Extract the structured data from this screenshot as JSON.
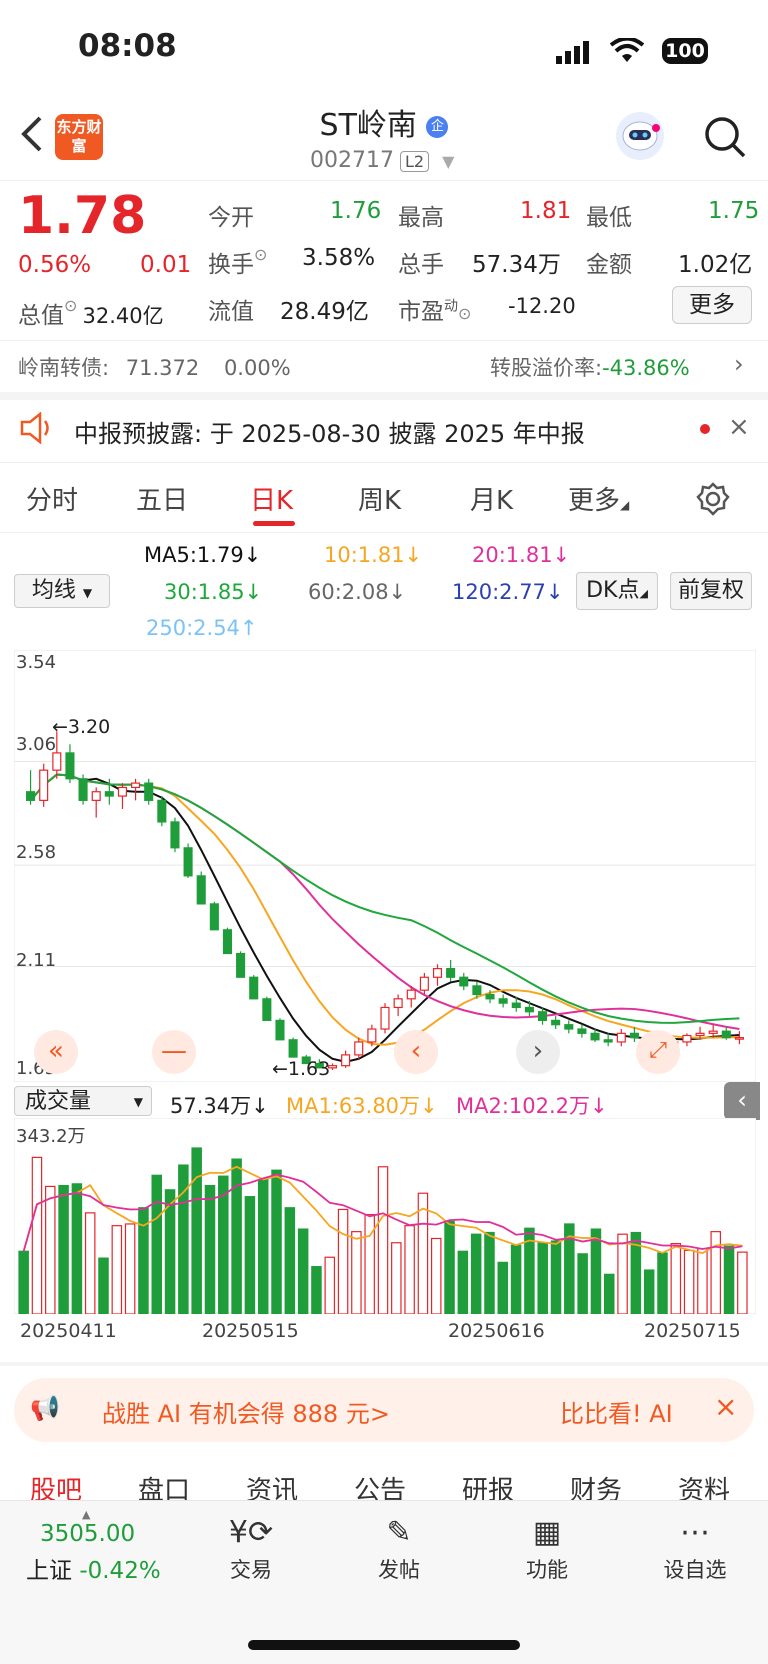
{
  "status": {
    "time": "08:08",
    "battery": "100"
  },
  "header": {
    "logo": "东方财富",
    "title": "ST岭南",
    "code": "002717",
    "level": "L2"
  },
  "quote": {
    "price": "1.78",
    "change_pct": "0.56%",
    "change": "0.01",
    "open_label": "今开",
    "open": "1.76",
    "high_label": "最高",
    "high": "1.81",
    "low_label": "最低",
    "low": "1.75",
    "turnover_label": "换手",
    "turnover": "3.58%",
    "volume_label": "总手",
    "volume": "57.34万",
    "amount_label": "金额",
    "amount": "1.02亿",
    "mktcap_label": "总值",
    "mktcap": "32.40亿",
    "float_label": "流值",
    "float": "28.49亿",
    "pe_label": "市盈",
    "pe_sup": "动",
    "pe": "-12.20",
    "more": "更多"
  },
  "bond": {
    "name": "岭南转债:",
    "price": "71.372",
    "chg": "0.00%",
    "premium_label": "转股溢价率:",
    "premium": "-43.86%"
  },
  "notice": {
    "text": "中报预披露: 于 2025-08-30 披露 2025 年中报"
  },
  "ktabs": [
    "分时",
    "五日",
    "日K",
    "周K",
    "月K",
    "更多"
  ],
  "ma_legend": {
    "ma5": "MA5:1.79↓",
    "ma10": "10:1.81↓",
    "ma20": "20:1.81↓",
    "ma30": "30:1.85↓",
    "ma60": "60:2.08↓",
    "ma120": "120:2.77↓",
    "ma250": "250:2.54↑",
    "selector": "均线",
    "dk": "DK点",
    "adjust": "前复权"
  },
  "kchart": {
    "y_labels": [
      "3.54",
      "3.06",
      "2.58",
      "2.11",
      "1.63"
    ],
    "high_mark": "3.20",
    "low_mark": "1.63"
  },
  "volume": {
    "selector": "成交量",
    "vol": "57.34万↓",
    "ma1": "MA1:63.80万↓",
    "ma2": "MA2:102.2万↓",
    "max_label": "343.2万",
    "dates": [
      "20250411",
      "20250515",
      "20250616",
      "20250715"
    ]
  },
  "colors": {
    "up": "#e4262b",
    "down": "#1f9d3a",
    "ma5": "#111111",
    "ma10": "#f6a623",
    "ma20": "#e0309a",
    "ma30": "#1ea83c",
    "ma60": "#666666",
    "ma120": "#2c3fb5",
    "ma250": "#7cc3f5"
  },
  "ad": {
    "text": "战胜 AI 有机会得 888 元>",
    "cta": "比比看! AI"
  },
  "subtabs": [
    "股吧",
    "盘口",
    "资讯",
    "公告",
    "研报",
    "财务",
    "资料"
  ],
  "bottom_nav": {
    "index_value": "3505.00",
    "index_name": "上证",
    "index_chg": "-0.42%",
    "items": [
      "交易",
      "发帖",
      "功能",
      "设自选"
    ]
  },
  "chart_data": {
    "type": "candlestick",
    "ohlc": [
      [
        2.92,
        3.02,
        2.86,
        2.88
      ],
      [
        2.88,
        3.05,
        2.85,
        3.02
      ],
      [
        3.02,
        3.2,
        2.98,
        3.1
      ],
      [
        3.1,
        3.14,
        2.96,
        2.98
      ],
      [
        2.98,
        3.0,
        2.86,
        2.88
      ],
      [
        2.88,
        2.94,
        2.8,
        2.92
      ],
      [
        2.92,
        2.98,
        2.86,
        2.9
      ],
      [
        2.9,
        2.96,
        2.84,
        2.94
      ],
      [
        2.94,
        2.98,
        2.88,
        2.96
      ],
      [
        2.96,
        2.98,
        2.86,
        2.88
      ],
      [
        2.88,
        2.9,
        2.76,
        2.78
      ],
      [
        2.78,
        2.8,
        2.64,
        2.66
      ],
      [
        2.66,
        2.68,
        2.52,
        2.53
      ],
      [
        2.53,
        2.55,
        2.4,
        2.4
      ],
      [
        2.4,
        2.41,
        2.28,
        2.28
      ],
      [
        2.28,
        2.29,
        2.17,
        2.17
      ],
      [
        2.17,
        2.18,
        2.06,
        2.06
      ],
      [
        2.06,
        2.07,
        1.96,
        1.96
      ],
      [
        1.96,
        1.97,
        1.86,
        1.86
      ],
      [
        1.86,
        1.87,
        1.77,
        1.77
      ],
      [
        1.77,
        1.78,
        1.69,
        1.69
      ],
      [
        1.69,
        1.7,
        1.66,
        1.66
      ],
      [
        1.66,
        1.68,
        1.64,
        1.64
      ],
      [
        1.64,
        1.66,
        1.63,
        1.65
      ],
      [
        1.65,
        1.72,
        1.64,
        1.7
      ],
      [
        1.7,
        1.78,
        1.68,
        1.76
      ],
      [
        1.76,
        1.84,
        1.74,
        1.82
      ],
      [
        1.82,
        1.94,
        1.8,
        1.92
      ],
      [
        1.92,
        1.98,
        1.88,
        1.96
      ],
      [
        1.96,
        2.02,
        1.92,
        2.0
      ],
      [
        2.0,
        2.08,
        1.98,
        2.06
      ],
      [
        2.06,
        2.12,
        2.02,
        2.1
      ],
      [
        2.1,
        2.14,
        2.04,
        2.06
      ],
      [
        2.06,
        2.08,
        2.0,
        2.02
      ],
      [
        2.02,
        2.04,
        1.96,
        1.98
      ],
      [
        1.98,
        2.0,
        1.94,
        1.96
      ],
      [
        1.96,
        1.98,
        1.92,
        1.94
      ],
      [
        1.94,
        1.97,
        1.9,
        1.92
      ],
      [
        1.92,
        1.95,
        1.88,
        1.9
      ],
      [
        1.9,
        1.92,
        1.84,
        1.86
      ],
      [
        1.86,
        1.88,
        1.82,
        1.84
      ],
      [
        1.84,
        1.86,
        1.8,
        1.82
      ],
      [
        1.82,
        1.84,
        1.78,
        1.8
      ],
      [
        1.8,
        1.82,
        1.76,
        1.77
      ],
      [
        1.77,
        1.8,
        1.74,
        1.76
      ],
      [
        1.76,
        1.82,
        1.74,
        1.8
      ],
      [
        1.8,
        1.83,
        1.76,
        1.78
      ],
      [
        1.78,
        1.8,
        1.74,
        1.77
      ],
      [
        1.77,
        1.79,
        1.75,
        1.76
      ],
      [
        1.76,
        1.78,
        1.74,
        1.76
      ],
      [
        1.76,
        1.8,
        1.74,
        1.79
      ],
      [
        1.79,
        1.83,
        1.77,
        1.8
      ],
      [
        1.8,
        1.84,
        1.78,
        1.81
      ],
      [
        1.81,
        1.83,
        1.77,
        1.78
      ],
      [
        1.78,
        1.81,
        1.75,
        1.78
      ]
    ],
    "ylim": [
      1.63,
      3.54
    ]
  }
}
